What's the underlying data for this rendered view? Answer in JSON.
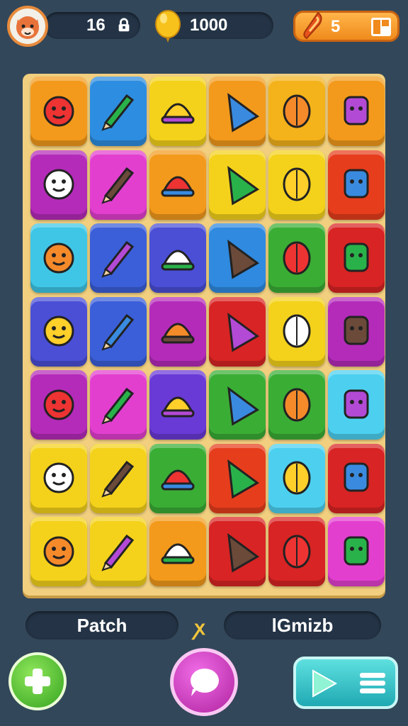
{
  "hud": {
    "level": "16",
    "coins": "1000",
    "energy": "5"
  },
  "board": {
    "rows": [
      [
        {
          "color": "#f39a1c",
          "icon": "green-bell-icon"
        },
        {
          "color": "#2d8de0",
          "icon": "red-bell-icon"
        },
        {
          "color": "#f4d21b",
          "icon": "pencil-icon"
        },
        {
          "color": "#f39a1c",
          "icon": "red-cone-icon"
        },
        {
          "color": "#f4b21b",
          "icon": "bullet-icon"
        },
        {
          "color": "#f39a1c",
          "icon": "sheep-icon"
        }
      ],
      [
        {
          "color": "#b42bb9",
          "icon": "candy-icon"
        },
        {
          "color": "#e23fcf",
          "icon": "red-blob-icon"
        },
        {
          "color": "#f39a1c",
          "icon": "cat-face-icon"
        },
        {
          "color": "#f4d21b",
          "icon": "green-pencil-icon"
        },
        {
          "color": "#f4d21b",
          "icon": "blue-flower-icon"
        },
        {
          "color": "#e63d1d",
          "icon": "magnifier-icon"
        }
      ],
      [
        {
          "color": "#3fc6e6",
          "icon": "pink-blob-icon"
        },
        {
          "color": "#3b5fd8",
          "icon": "yellow-sun-icon"
        },
        {
          "color": "#4a4fd6",
          "icon": "elephant-icon"
        },
        {
          "color": "#2f8ae0",
          "icon": "yellow-pencil-icon"
        },
        {
          "color": "#3aad35",
          "icon": "leaf-icon"
        },
        {
          "color": "#d82424",
          "icon": "shell-icon"
        }
      ],
      [
        {
          "color": "#4a4fd6",
          "icon": "ice-cream-icon"
        },
        {
          "color": "#3b5fd8",
          "icon": "red-monster-icon"
        },
        {
          "color": "#b42bb9",
          "icon": "crossed-sticks-icon"
        },
        {
          "color": "#d82424",
          "icon": "cup-icon"
        },
        {
          "color": "#f4d21b",
          "icon": "blue-fish-icon"
        },
        {
          "color": "#b42bb9",
          "icon": "yellow-cone-icon"
        }
      ],
      [
        {
          "color": "#b42bb9",
          "icon": "yellow-glove-icon"
        },
        {
          "color": "#e23fcf",
          "icon": "blue-elephant-icon"
        },
        {
          "color": "#6a3ad6",
          "icon": "bottle-icon"
        },
        {
          "color": "#3aad35",
          "icon": "banana-icon"
        },
        {
          "color": "#3aad35",
          "icon": "fern-icon"
        },
        {
          "color": "#4dd0f0",
          "icon": "horn-icon"
        }
      ],
      [
        {
          "color": "#f4d21b",
          "icon": "lollipop-icon"
        },
        {
          "color": "#f4d21b",
          "icon": "onion-icon"
        },
        {
          "color": "#3aad35",
          "icon": "tree-icon"
        },
        {
          "color": "#e63d1d",
          "icon": "orange-blob-icon"
        },
        {
          "color": "#4dd0f0",
          "icon": "helmet-icon"
        },
        {
          "color": "#d82424",
          "icon": "hat-icon"
        }
      ],
      [
        {
          "color": "#f4d21b",
          "icon": "eraser-icon"
        },
        {
          "color": "#f4d21b",
          "icon": "orange-bird-icon"
        },
        {
          "color": "#f39a1c",
          "icon": "orange-cat-icon"
        },
        {
          "color": "#d82424",
          "icon": "white-cone-icon"
        },
        {
          "color": "#d82424",
          "icon": "brown-bullet-icon"
        },
        {
          "color": "#e23fcf",
          "icon": "robot-jar-icon"
        }
      ]
    ]
  },
  "footer": {
    "left_label": "Patch",
    "separator": "ꭗ",
    "right_label": "lGmizb"
  }
}
